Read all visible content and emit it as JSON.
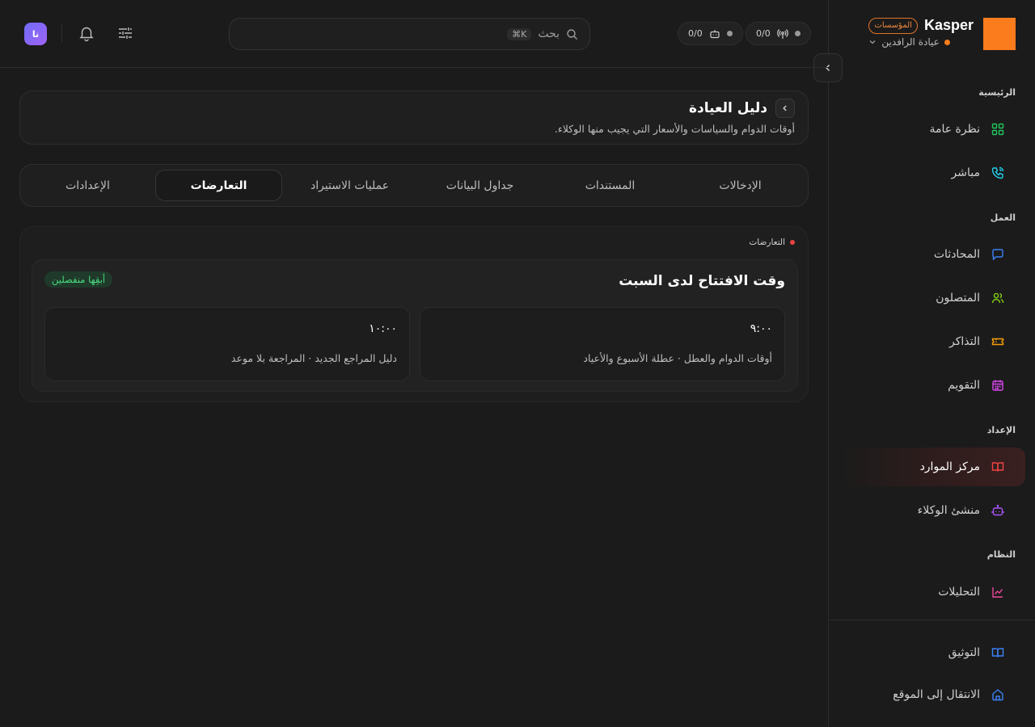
{
  "brand": {
    "name": "Kasper",
    "badge": "المؤسسات",
    "workspace": "عيادة الرافدين"
  },
  "sidebar": {
    "sections": {
      "home": "الرئيسية",
      "work": "العمل",
      "setup": "الإعداد",
      "system": "النظام"
    },
    "items": [
      {
        "label": "نظرة عامة",
        "icon": "grid-icon",
        "color": "#22c55e"
      },
      {
        "label": "مباشر",
        "icon": "phone-icon",
        "color": "#22d3ee"
      },
      {
        "label": "المحادثات",
        "icon": "chat-icon",
        "color": "#3b82f6"
      },
      {
        "label": "المتصلون",
        "icon": "users-icon",
        "color": "#84cc16"
      },
      {
        "label": "التذاكر",
        "icon": "ticket-icon",
        "color": "#f59e0b"
      },
      {
        "label": "التقويم",
        "icon": "calendar-icon",
        "color": "#d946ef"
      },
      {
        "label": "مركز الموارد",
        "icon": "book-icon",
        "color": "#ef4444",
        "active": true
      },
      {
        "label": "منشئ الوكلاء",
        "icon": "bot-icon",
        "color": "#a855f7"
      },
      {
        "label": "التحليلات",
        "icon": "chart-icon",
        "color": "#ec4899"
      }
    ],
    "footer": [
      {
        "label": "التوثيق",
        "icon": "book-icon",
        "color": "#3b82f6"
      },
      {
        "label": "الانتقال إلى الموقع",
        "icon": "home-icon",
        "color": "#3b82f6"
      }
    ]
  },
  "topbar": {
    "stat_calls": "0/0",
    "stat_bots": "0/0",
    "search_placeholder": "بحث",
    "search_shortcut": "⌘K",
    "avatar_initials": "نا"
  },
  "page": {
    "title": "دليل العيادة",
    "description": "أوقات الدوام والسياسات والأسعار التي يجيب منها الوكلاء."
  },
  "tabs": [
    "الإدخالات",
    "المستندات",
    "جداول البيانات",
    "عمليات الاستيراد",
    "التعارضات",
    "الإعدادات"
  ],
  "active_tab": "التعارضات",
  "conflicts": {
    "section_label": "التعارضات",
    "items": [
      {
        "title": "وقت الافتتاح لدى السبت",
        "action": "أبقِها منفصلين",
        "values": [
          {
            "time": "٩:٠٠",
            "source": "أوقات الدوام والعطل · عطلة الأسبوع والأعياد"
          },
          {
            "time": "١٠:٠٠",
            "source": "دليل المراجع الجديد · المراجعة بلا موعد"
          }
        ]
      }
    ]
  },
  "colors": {
    "accent": "#fb7c1c",
    "active_nav": "#ef4444",
    "success": "#4ade80"
  }
}
